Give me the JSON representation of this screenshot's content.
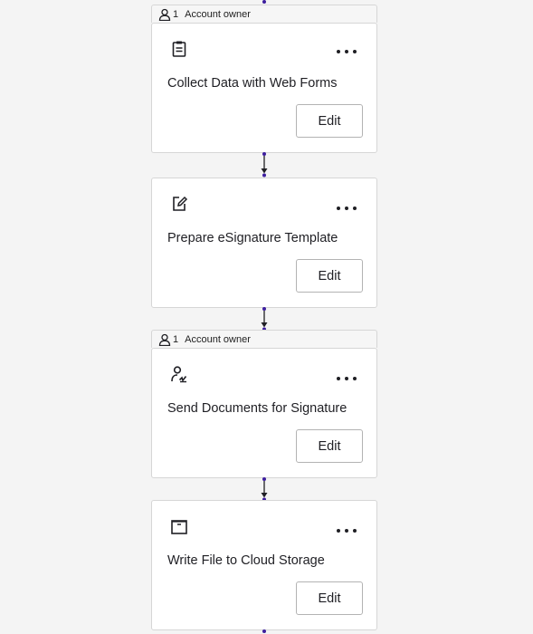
{
  "workflow": {
    "steps": [
      {
        "has_assignee": true,
        "assignee_count": "1",
        "assignee_label": "Account owner",
        "icon": "clipboard-icon",
        "title": "Collect Data with Web Forms",
        "edit_label": "Edit"
      },
      {
        "has_assignee": false,
        "icon": "edit-document-icon",
        "title": "Prepare eSignature Template",
        "edit_label": "Edit"
      },
      {
        "has_assignee": true,
        "assignee_count": "1",
        "assignee_label": "Account owner",
        "icon": "person-sign-icon",
        "title": "Send Documents for Signature",
        "edit_label": "Edit"
      },
      {
        "has_assignee": false,
        "icon": "archive-box-icon",
        "title": "Write File to Cloud Storage",
        "edit_label": "Edit"
      }
    ],
    "colors": {
      "background": "#f4f4f4",
      "card": "#ffffff",
      "border": "#d6d6d6",
      "connector_dot": "#3d1e9e",
      "text": "#1f1f24"
    }
  }
}
